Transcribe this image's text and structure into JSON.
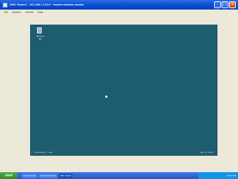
{
  "window": {
    "title": "[VNC Viewer] - 192.168.1.123:0 - remote desktop session",
    "buttons": {
      "minimize": "_",
      "maximize": "□",
      "close": "×"
    }
  },
  "menu": [
    "File",
    "Options",
    "Control",
    "Help"
  ],
  "remote_desktop": {
    "background_color": "#1e5c70",
    "icon_label": "Recycle Bin",
    "status_left": "Connected - 1 ms",
    "status_right": "Apr 11, 2017"
  },
  "taskbar": {
    "start_label": "start",
    "tasks": [
      "My Computer",
      "Remote Desktop",
      "VNC Viewer"
    ],
    "tray_time": "10:42 PM"
  },
  "colors": {
    "titlebar": "#0a4fd8",
    "window_bg": "#ece9d8",
    "taskbar": "#2458c8",
    "start_button": "#2e8a2e"
  }
}
